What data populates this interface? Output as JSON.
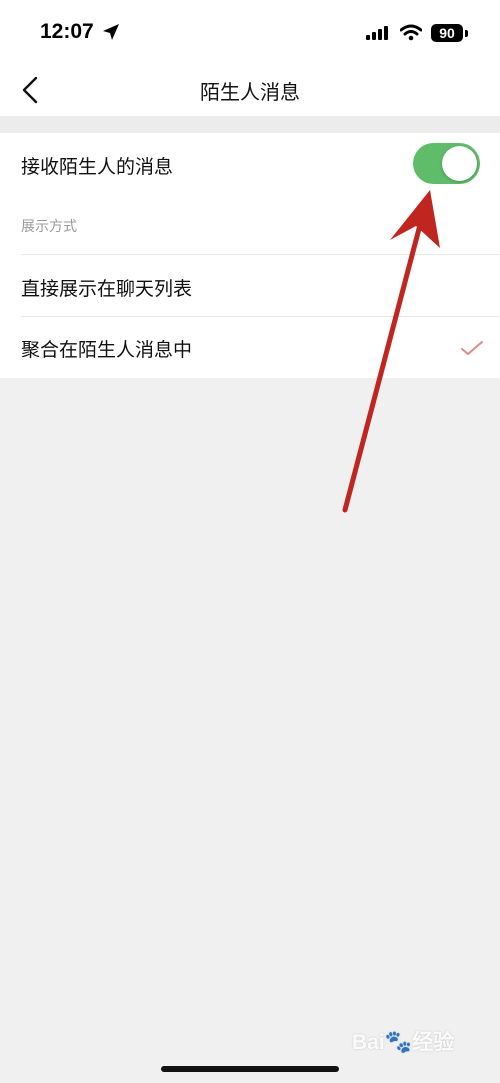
{
  "status_bar": {
    "time": "12:07",
    "battery": "90",
    "icons": [
      "location-arrow-icon",
      "signal-bars-icon",
      "wifi-icon",
      "battery-icon"
    ]
  },
  "header": {
    "title": "陌生人消息",
    "back_icon": "chevron-left-icon"
  },
  "settings": {
    "receive": {
      "label": "接收陌生人的消息",
      "enabled": true,
      "toggle_color": "#5fbd6a"
    },
    "display_section": {
      "title": "展示方式",
      "options": [
        {
          "label": "直接展示在聊天列表",
          "selected": false
        },
        {
          "label": "聚合在陌生人消息中",
          "selected": true
        }
      ],
      "check_color": "#e08a80"
    }
  },
  "annotation": {
    "arrow_color": "#c0261f"
  },
  "watermark": {
    "text_a": "Bai",
    "text_b": "经验"
  }
}
